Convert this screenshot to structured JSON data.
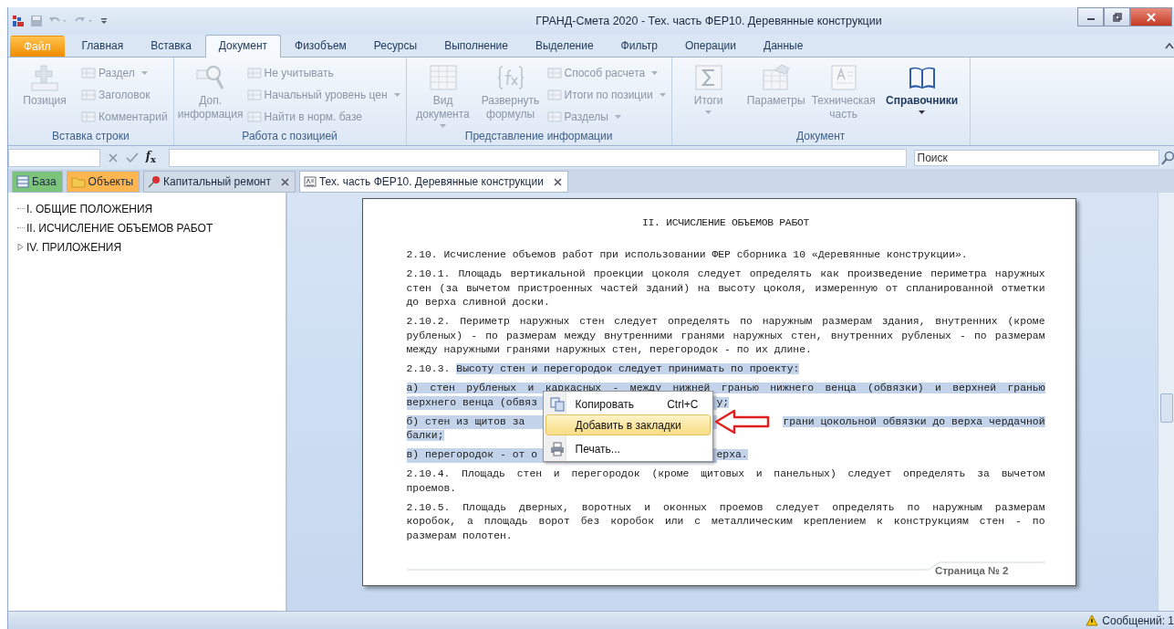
{
  "window": {
    "title": "ГРАНД-Смета 2020 - Тех. часть ФЕР10. Деревянные конструкции"
  },
  "ribbon_tabs": [
    {
      "label": "Файл",
      "kind": "file",
      "selected": false
    },
    {
      "label": "Главная",
      "kind": "tab",
      "selected": false
    },
    {
      "label": "Вставка",
      "kind": "tab",
      "selected": false
    },
    {
      "label": "Документ",
      "kind": "tab",
      "selected": true
    },
    {
      "label": "Физобъем",
      "kind": "tab",
      "selected": false
    },
    {
      "label": "Ресурсы",
      "kind": "tab",
      "selected": false
    },
    {
      "label": "Выполнение",
      "kind": "tab",
      "selected": false
    },
    {
      "label": "Выделение",
      "kind": "tab",
      "selected": false
    },
    {
      "label": "Фильтр",
      "kind": "tab",
      "selected": false
    },
    {
      "label": "Операции",
      "kind": "tab",
      "selected": false
    },
    {
      "label": "Данные",
      "kind": "tab",
      "selected": false
    }
  ],
  "ribbon_groups": [
    {
      "label": "Вставка строки",
      "items": [
        {
          "label": "Позиция",
          "kind": "large",
          "dropdown": false,
          "disabled": true
        },
        {
          "label": "Раздел",
          "kind": "small",
          "dropdown": true,
          "disabled": true
        },
        {
          "label": "Заголовок",
          "kind": "small",
          "dropdown": false,
          "disabled": true
        },
        {
          "label": "Комментарий",
          "kind": "small",
          "dropdown": false,
          "disabled": true
        }
      ]
    },
    {
      "label": "Работа с позицией",
      "items": [
        {
          "label": "Доп. информация",
          "kind": "large",
          "dropdown": false,
          "disabled": true
        },
        {
          "label": "Не учитывать",
          "kind": "small",
          "dropdown": false,
          "disabled": true
        },
        {
          "label": "Начальный уровень цен",
          "kind": "small",
          "dropdown": true,
          "disabled": true
        },
        {
          "label": "Найти в норм. базе",
          "kind": "small",
          "dropdown": false,
          "disabled": true
        }
      ]
    },
    {
      "label": "Представление информации",
      "items": [
        {
          "label": "Вид документа",
          "kind": "large",
          "dropdown": true,
          "disabled": true
        },
        {
          "label": "Развернуть формулы",
          "kind": "large",
          "dropdown": false,
          "disabled": true
        },
        {
          "label": "Способ расчета",
          "kind": "small",
          "dropdown": true,
          "disabled": true
        },
        {
          "label": "Итоги по позиции",
          "kind": "small",
          "dropdown": true,
          "disabled": true
        },
        {
          "label": "Разделы",
          "kind": "small",
          "dropdown": true,
          "disabled": true
        }
      ]
    },
    {
      "label": "Документ",
      "items": [
        {
          "label": "Итоги",
          "kind": "large",
          "dropdown": true,
          "disabled": true
        },
        {
          "label": "Параметры",
          "kind": "large",
          "dropdown": false,
          "disabled": true
        },
        {
          "label": "Техническая часть",
          "kind": "large",
          "dropdown": false,
          "disabled": true
        },
        {
          "label": "Справочники",
          "kind": "large",
          "dropdown": true,
          "disabled": false
        }
      ]
    }
  ],
  "formula_bar": {
    "function_button": "*f*$_{x}$",
    "search": {
      "placeholder": "Поиск"
    }
  },
  "doc_tabs": [
    {
      "label": "База",
      "color": "#7cc47a",
      "closable": false,
      "selected": false
    },
    {
      "label": "Объекты",
      "color": "#ffb650",
      "closable": false,
      "selected": false
    },
    {
      "label": "Капитальный ремонт",
      "closable": true,
      "selected": false
    },
    {
      "label": "Тех. часть ФЕР10. Деревянные конструкции",
      "closable": true,
      "selected": true
    }
  ],
  "tree": [
    {
      "label": "I. ОБЩИЕ ПОЛОЖЕНИЯ",
      "expandable": false
    },
    {
      "label": "II. ИСЧИСЛЕНИЕ ОБЪЕМОВ РАБОТ",
      "expandable": false
    },
    {
      "label": "IV. ПРИЛОЖЕНИЯ",
      "expandable": true
    }
  ],
  "document": {
    "heading": "II. ИСЧИСЛЕНИЕ ОБЪЕМОВ РАБОТ",
    "paragraphs": [
      [
        {
          "kind": "full",
          "segments": [
            {
              "text": "2.10. Исчисление объемов работ при использовании ФЕР сборника 10 «Деревянные конструкции».",
              "selected": false
            }
          ]
        }
      ],
      [
        {
          "kind": "full",
          "segments": [
            {
              "text": "2.10.1. Площадь вертикальной проекции цоколя следует определять как произведение периметра наружных",
              "selected": false
            }
          ]
        },
        {
          "kind": "full",
          "segments": [
            {
              "text": "стен (за вычетом пристроенных частей зданий) на высоту цоколя, измеренную от спланированной отметки",
              "selected": false
            }
          ]
        },
        {
          "kind": "full",
          "segments": [
            {
              "text": "до верха сливной доски.",
              "selected": false
            }
          ]
        }
      ],
      [
        {
          "kind": "full",
          "segments": [
            {
              "text": "2.10.2. Периметр наружных стен следует определять по наружным размерам здания, внутренних (кроме",
              "selected": false
            }
          ]
        },
        {
          "kind": "full",
          "segments": [
            {
              "text": "рубленых) - по размерам между внутренними гранями наружных стен, внутренних рубленых - по размерам",
              "selected": false
            }
          ]
        },
        {
          "kind": "full",
          "segments": [
            {
              "text": "между наружными гранями наружных стен, перегородок - по их длине.",
              "selected": false
            }
          ]
        }
      ],
      [
        {
          "kind": "full",
          "segments": [
            {
              "text": "2.10.3.",
              "selected": false
            },
            {
              "text": "Высоту стен и перегородок следует принимать по проекту:",
              "selected": true
            }
          ]
        }
      ],
      [
        {
          "kind": "full",
          "segments": [
            {
              "text": "а) стен рубленых и каркасных - между нижней гранью нижнего венца (обвязки) и верхней гранью",
              "selected": true
            }
          ]
        },
        {
          "kind": "covered",
          "segments": [
            {
              "text": "верхнего венца (обвяз",
              "selected": true
            },
            {
              "text": "у;",
              "selected": true
            }
          ]
        }
      ],
      [
        {
          "kind": "covered",
          "segments": [
            {
              "text": "б) стен из щитов за",
              "selected": true
            },
            {
              "text": "грани цокольной обвязки до верха чердачной",
              "selected": true
            }
          ]
        },
        {
          "kind": "full",
          "segments": [
            {
              "text": "балки;",
              "selected": true
            }
          ]
        }
      ],
      [
        {
          "kind": "covered",
          "segments": [
            {
              "text": "в) перегородок - от о",
              "selected": true
            },
            {
              "text": "ерха.",
              "selected": true
            }
          ]
        }
      ],
      [
        {
          "kind": "full",
          "segments": [
            {
              "text": "2.10.4. Площадь стен и перегородок (кроме щитовых и панельных) следует определять за вычетом",
              "selected": false
            }
          ]
        },
        {
          "kind": "full",
          "segments": [
            {
              "text": "проемов.",
              "selected": false
            }
          ]
        }
      ],
      [
        {
          "kind": "full",
          "segments": [
            {
              "text": "2.10.5. Площадь дверных, воротных и оконных проемов следует определять по наружным размерам",
              "selected": false
            }
          ]
        },
        {
          "kind": "full",
          "segments": [
            {
              "text": "коробок, а площадь ворот без коробок или с металлическим креплением к конструкциям стен - по",
              "selected": false
            }
          ]
        },
        {
          "kind": "full",
          "segments": [
            {
              "text": "размерам полотен.",
              "selected": false
            }
          ]
        }
      ]
    ],
    "footer": "Страница № 2"
  },
  "context_menu": [
    {
      "label": "Копировать",
      "shortcut": "Ctrl+C",
      "selected": false
    },
    {
      "label": "Добавить в закладки",
      "selected": true
    },
    {
      "label": "Печать...",
      "selected": false
    }
  ],
  "status_bar": {
    "messages": "Сообщений: 1"
  }
}
